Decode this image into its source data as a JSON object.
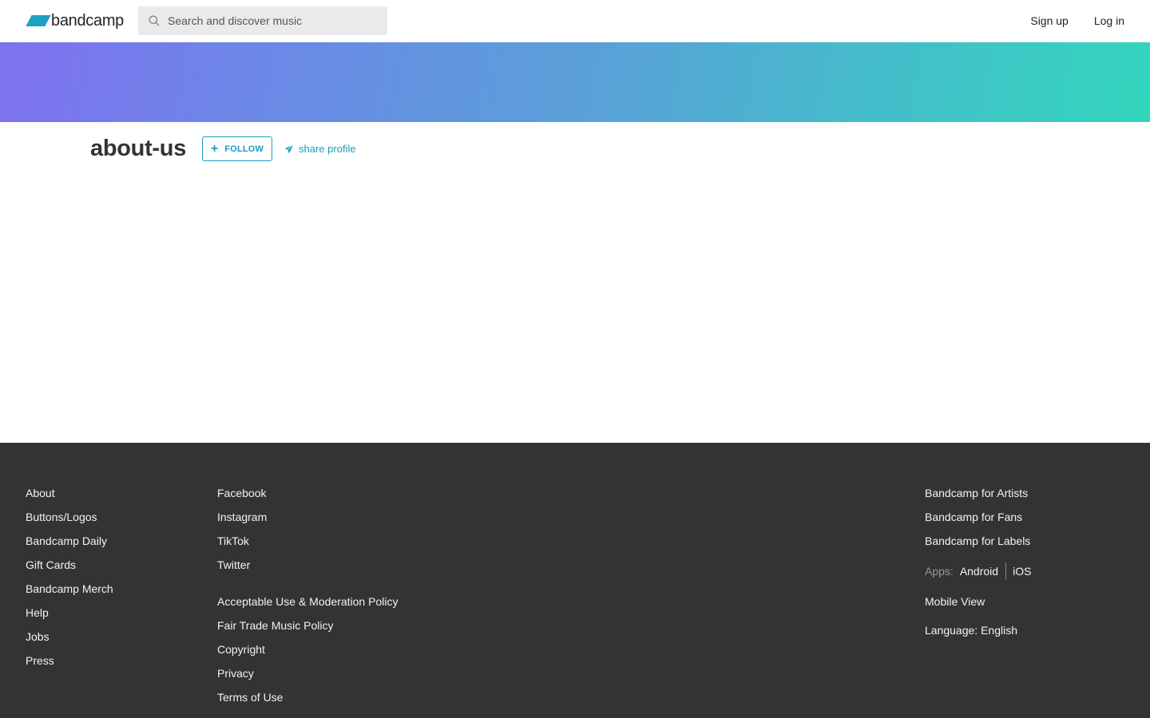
{
  "header": {
    "logo_text": "bandcamp",
    "search_placeholder": "Search and discover music",
    "signup_label": "Sign up",
    "login_label": "Log in"
  },
  "profile": {
    "name": "about-us",
    "follow_label": "FOLLOW",
    "share_label": "share profile"
  },
  "footer": {
    "col1": [
      "About",
      "Buttons/Logos",
      "Bandcamp Daily",
      "Gift Cards",
      "Bandcamp Merch",
      "Help",
      "Jobs",
      "Press"
    ],
    "col2_social": [
      "Facebook",
      "Instagram",
      "TikTok",
      "Twitter"
    ],
    "col2_policy": [
      "Acceptable Use & Moderation Policy",
      "Fair Trade Music Policy",
      "Copyright",
      "Privacy",
      "Terms of Use"
    ],
    "col3": [
      "Bandcamp for Artists",
      "Bandcamp for Fans",
      "Bandcamp for Labels"
    ],
    "apps_label": "Apps:",
    "apps_android": "Android",
    "apps_ios": "iOS",
    "mobile_view": "Mobile View",
    "language": "Language: English"
  },
  "colors": {
    "accent": "#1a9bbf",
    "footer_bg": "#333333",
    "banner_start": "#7f71f0",
    "banner_end": "#33d6bd"
  },
  "icons": {
    "logo": "bandcamp-logo-icon",
    "search": "search-icon",
    "follow": "plus-icon",
    "share": "paper-plane-icon"
  }
}
